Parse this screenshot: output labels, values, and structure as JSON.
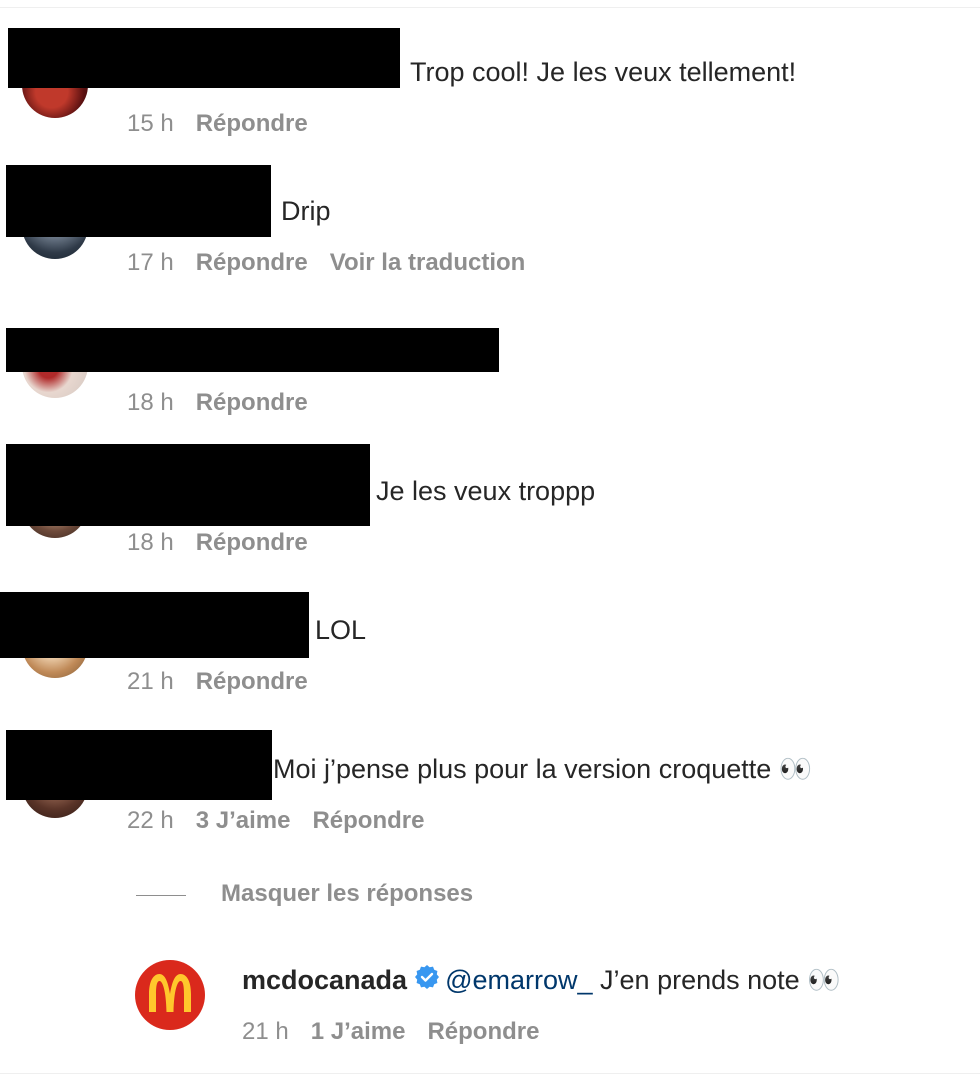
{
  "comments": [
    {
      "text": "Trop cool! Je les veux tellement!",
      "time": "15 h",
      "reply": "Répondre"
    },
    {
      "text": "Drip",
      "time": "17 h",
      "reply": "Répondre",
      "translate": "Voir la traduction"
    },
    {
      "text": "",
      "time": "18 h",
      "reply": "Répondre"
    },
    {
      "text": "Je les veux troppp",
      "time": "18 h",
      "reply": "Répondre"
    },
    {
      "text": "LOL",
      "time": "21 h",
      "reply": "Répondre"
    },
    {
      "text": "Moi j’pense plus pour la version croquette 👀",
      "time": "22 h",
      "likes": "3 J’aime",
      "reply": "Répondre"
    }
  ],
  "thread": {
    "hide_replies": "Masquer les réponses",
    "reply": {
      "username": "mcdocanada",
      "mention": "@emarrow_",
      "text": "J’en prends note 👀",
      "time": "21 h",
      "likes": "1 J’aime",
      "reply_label": "Répondre"
    }
  },
  "colors": {
    "text": "#262626",
    "meta": "#8e8e8e",
    "mention": "#00376b",
    "verified": "#3897f0",
    "brand_red": "#da291c",
    "brand_yellow": "#ffc72c"
  }
}
